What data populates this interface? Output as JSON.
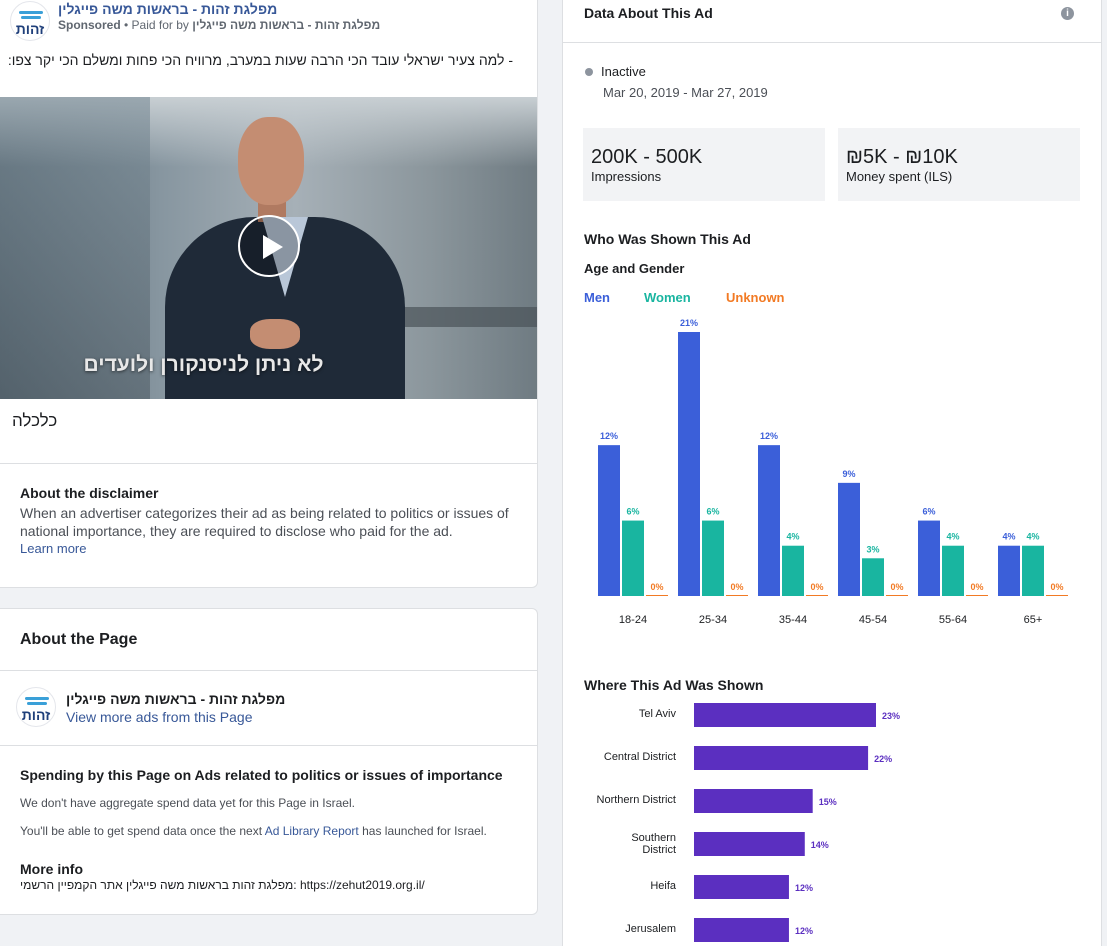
{
  "ad": {
    "page_name": "מפלגת זהות - בראשות משה פייגלין",
    "sponsored": "Sponsored",
    "paid_for_by": "• Paid for by",
    "payer": "מפלגת זהות - בראשות משה פייגלין",
    "logo_text": "זהות",
    "body_text": "- למה צעיר ישראלי עובד הכי הרבה שעות במערב, מרוויח הכי פחות ומשלם הכי יקר צפו:",
    "video_caption": "לא ניתן לניסנקורן ולועדים",
    "play_icon": "play-icon",
    "category": "כלכלה",
    "disclaimer_title": "About the disclaimer",
    "disclaimer_body": "When an advertiser categorizes their ad as being related to politics or issues of national importance, they are required to disclose who paid for the ad.",
    "learn_more": "Learn more"
  },
  "about_page": {
    "title": "About the Page",
    "page_name": "מפלגת זהות - בראשות משה פייגלין",
    "view_more": "View more ads from this Page",
    "spending_title": "Spending by this Page on Ads related to politics or issues of importance",
    "spending_p1": "We don't have aggregate spend data yet for this Page in Israel.",
    "spending_p2_before": "You'll be able to get spend data once the next",
    "spending_p2_link": "Ad Library Report",
    "spending_p2_after": "has launched for Israel.",
    "more_info_title": "More info",
    "more_info_text": "מפלגת זהות בראשות משה פייגלין אתר הקמפיין הרשמי: https://zehut2019.org.il/"
  },
  "data_about": {
    "title": "Data About This Ad",
    "info_icon": "info-icon",
    "status": "Inactive",
    "dates": "Mar 20, 2019 - Mar 27, 2019",
    "impressions_value": "200K - 500K",
    "impressions_label": "Impressions",
    "spent_value": "₪5K - ₪10K",
    "spent_label": "Money spent (ILS)",
    "who_title": "Who Was Shown This Ad",
    "age_gender_title": "Age and Gender",
    "where_title": "Where This Ad Was Shown"
  },
  "colors": {
    "men": "#3b5fd9",
    "women": "#19b5a0",
    "unknown": "#f27a24",
    "region": "#5b2fc0",
    "link": "#385898"
  },
  "chart_data": [
    {
      "type": "bar",
      "title": "Age and Gender",
      "categories": [
        "18-24",
        "25-34",
        "35-44",
        "45-54",
        "55-64",
        "65+"
      ],
      "series": [
        {
          "name": "Men",
          "values": [
            12,
            21,
            12,
            9,
            6,
            4
          ]
        },
        {
          "name": "Women",
          "values": [
            6,
            6,
            4,
            3,
            4,
            4
          ]
        },
        {
          "name": "Unknown",
          "values": [
            0,
            0,
            0,
            0,
            0,
            0
          ]
        }
      ],
      "unit": "%",
      "legend": "top-left"
    },
    {
      "type": "bar",
      "orientation": "horizontal",
      "title": "Where This Ad Was Shown",
      "categories": [
        "Tel Aviv",
        "Central District",
        "Northern District",
        "Southern District",
        "Heifa",
        "Jerusalem"
      ],
      "values": [
        23,
        22,
        15,
        14,
        12,
        12
      ],
      "unit": "%"
    }
  ]
}
